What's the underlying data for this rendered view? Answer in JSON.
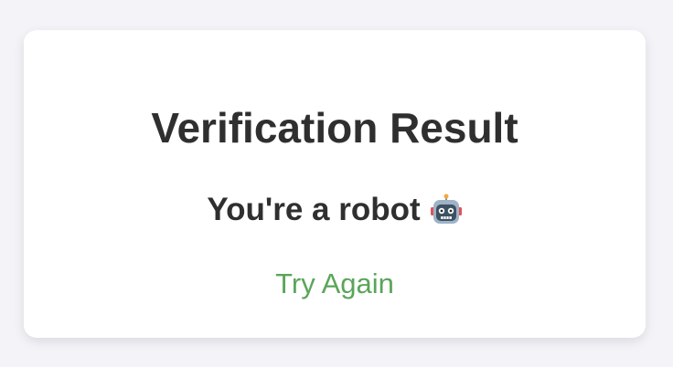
{
  "card": {
    "title": "Verification Result",
    "message": "You're a robot",
    "message_icon": "robot-icon",
    "retry_label": "Try Again"
  },
  "colors": {
    "background": "#f3f3f8",
    "card": "#ffffff",
    "text": "#2f2f2f",
    "link": "#5aa55a"
  }
}
